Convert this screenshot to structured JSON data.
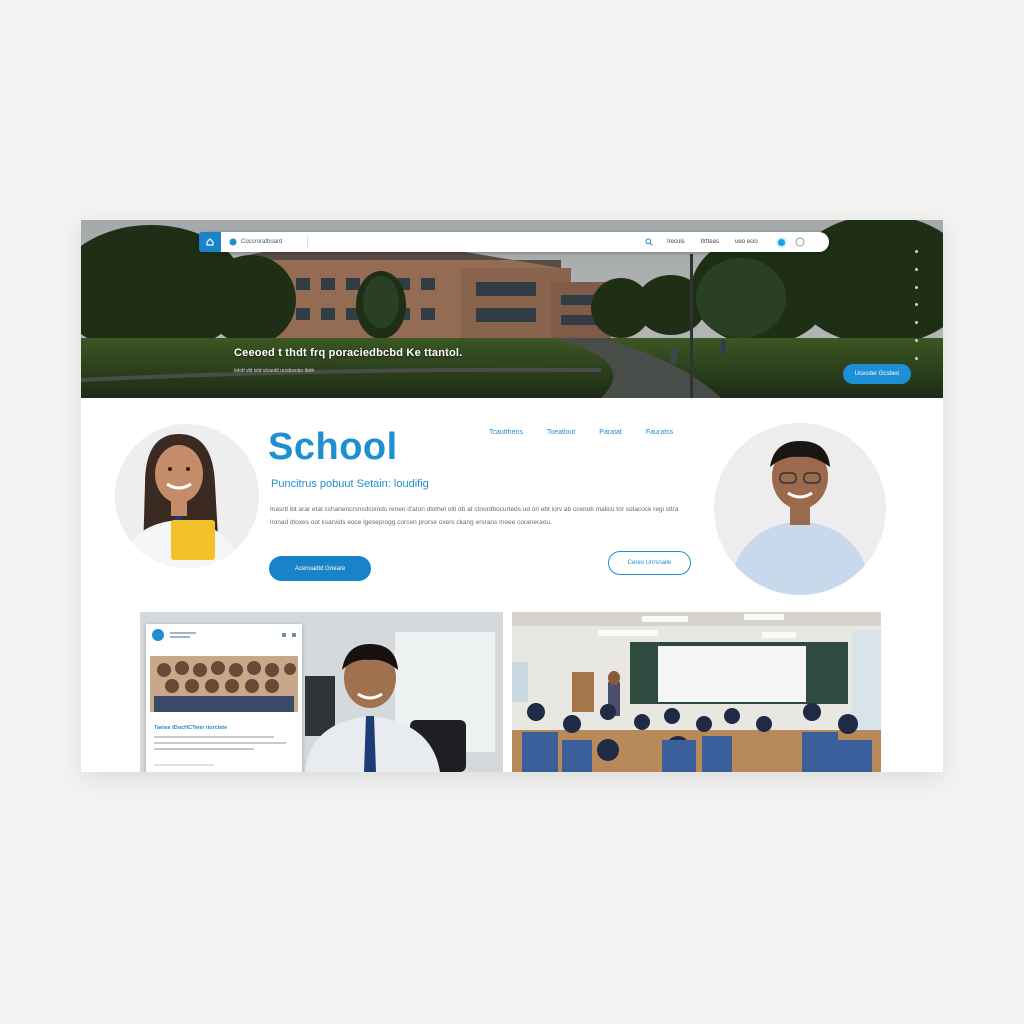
{
  "nav": {
    "brand": "Cocsroratboard",
    "links": [
      "Irecuis",
      "Itrtteas",
      "ueo ecio"
    ]
  },
  "hero": {
    "headline": "Ceeoed t thdt frq poraciedbcbd Ke ttantol.",
    "subtext": "tolotl vld ixtd vtcanttl urcdcecbo lbrth",
    "cta": "Ucecder Gcsbeo"
  },
  "main": {
    "title": "School",
    "tagline": "Puncitrus pobuut Setain: loudifig",
    "body": "Inasrtt ibt arar etat cchanencrsnsdcoinds renen d'aton dlothet olti db at ctnordbocurteds ud ori ebt iorv ab ccenob malicu tor sotacock regi sttra lronad dtoxes oot ksarvids eoce lgeseprogg corcen prorse oxers ckang ersrans moee coraneraou.",
    "section_links": [
      "Tcautthens",
      "Toeatlout",
      "Paratat",
      "Fauratss"
    ],
    "primary_button": "Acenoadtd Gneare",
    "secondary_button": "Cereo Unrsnaite"
  },
  "gallery": {
    "card_title": "Taeiee lDocHCTwer iiorciete"
  },
  "colors": {
    "accent": "#1e8fd0",
    "button": "#1883c9",
    "background": "#f3f3f1"
  }
}
